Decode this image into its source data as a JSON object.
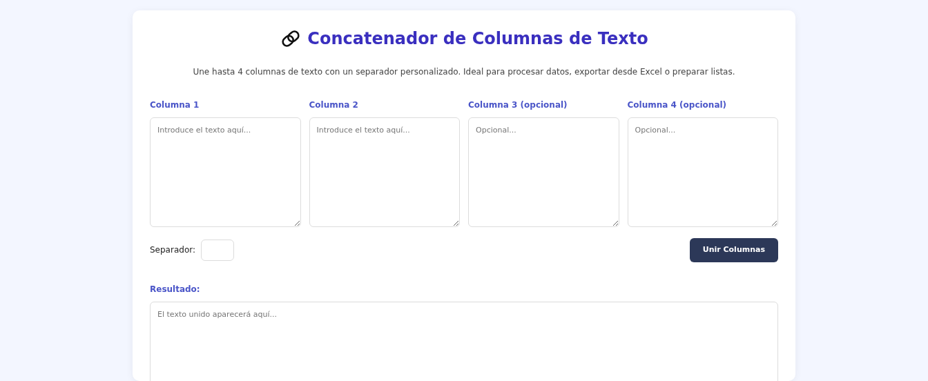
{
  "title": "Concatenador de Columnas de Texto",
  "description": "Une hasta 4 columnas de texto con un separador personalizado. Ideal para procesar datos, exportar desde Excel o preparar listas.",
  "columns": [
    {
      "label": "Columna 1",
      "placeholder": "Introduce el texto aquí..."
    },
    {
      "label": "Columna 2",
      "placeholder": "Introduce el texto aquí..."
    },
    {
      "label": "Columna 3 (opcional)",
      "placeholder": "Opcional..."
    },
    {
      "label": "Columna 4 (opcional)",
      "placeholder": "Opcional..."
    }
  ],
  "separator": {
    "label": "Separador:"
  },
  "button": "Unir Columnas",
  "result": {
    "label": "Resultado:",
    "placeholder": "El texto unido aparecerá aquí..."
  }
}
